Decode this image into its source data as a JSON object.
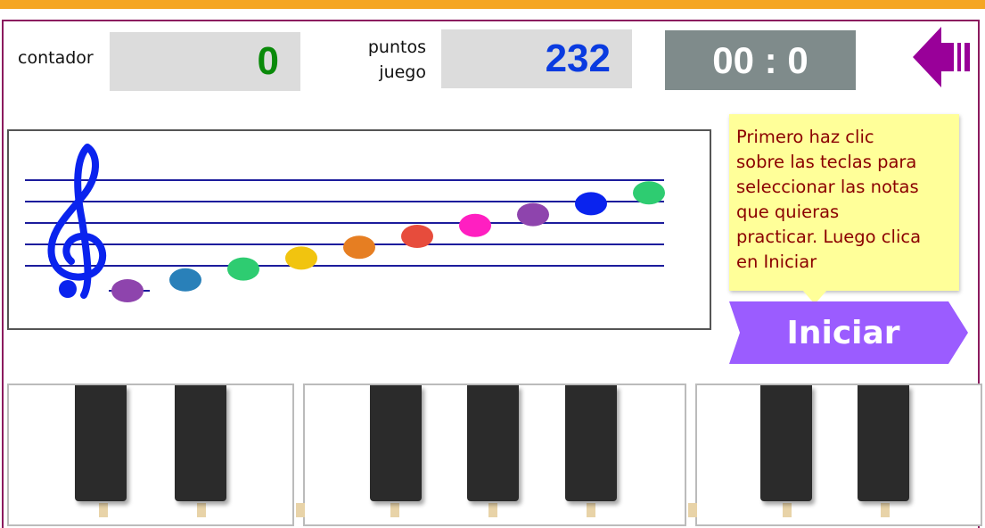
{
  "header": {
    "counter_label": "contador",
    "counter_value": "0",
    "points_label_line1": "puntos",
    "points_label_line2": "juego",
    "points_value": "232",
    "timer": "00 : 0"
  },
  "tooltip": {
    "lines": [
      "Primero haz clic",
      "sobre las teclas para",
      "seleccionar las notas",
      "que quieras",
      "practicar. Luego clica",
      "en Iniciar"
    ]
  },
  "start_button": {
    "label": "Iniciar"
  },
  "staff": {
    "clef": "treble-clef",
    "notes": [
      {
        "name": "note-1",
        "color": "#8e44ad"
      },
      {
        "name": "note-2",
        "color": "#2980b9"
      },
      {
        "name": "note-3",
        "color": "#2ecc71"
      },
      {
        "name": "note-4",
        "color": "#f1c40f"
      },
      {
        "name": "note-5",
        "color": "#e67e22"
      },
      {
        "name": "note-6",
        "color": "#e74c3c"
      },
      {
        "name": "note-7",
        "color": "#ff1fc1"
      },
      {
        "name": "note-8",
        "color": "#8e44ad"
      },
      {
        "name": "note-9",
        "color": "#0a23ee"
      },
      {
        "name": "note-10",
        "color": "#2ecc71"
      }
    ]
  },
  "colors": {
    "accent_bar": "#f5a623",
    "frame": "#8b1a5e",
    "counter_text": "#0a8a0a",
    "points_text": "#0a3be0",
    "back_arrow": "#990099",
    "start_button": "#9b5cff",
    "staff_lines": "#1c1c9c",
    "tooltip_text": "#8b0000"
  }
}
